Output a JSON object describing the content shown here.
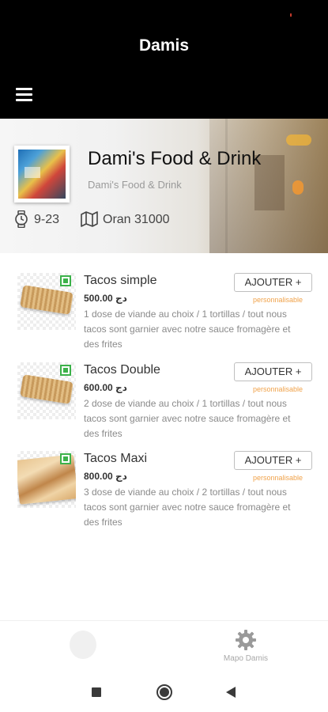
{
  "app": {
    "title": "Damis"
  },
  "header": {
    "menu_icon": "hamburger-menu-icon"
  },
  "restaurant": {
    "name": "Dami's Food & Drink",
    "subtitle": "Dami's Food & Drink",
    "hours": "9-23",
    "location": "Oran 31000",
    "hours_icon": "watch-icon",
    "location_icon": "map-icon"
  },
  "menu": {
    "items": [
      {
        "name": "Tacos simple",
        "price": "500.00 دج",
        "description": "1 dose de viande au choix / 1 tortillas / tout nous tacos sont garnier avec notre sauce fromagère et des frites",
        "add_label": "AJOUTER +",
        "tag": "personnalisable"
      },
      {
        "name": "Tacos Double",
        "price": "600.00 دج",
        "description": "2 dose de viande au choix / 1 tortillas / tout nous tacos sont garnier avec notre sauce fromagère et des frites",
        "add_label": "AJOUTER +",
        "tag": "personnalisable"
      },
      {
        "name": "Tacos Maxi",
        "price": "800.00 دج",
        "description": "3 dose de viande au choix / 2 tortillas / tout nous tacos sont garnier avec notre sauce fromagère et des frites",
        "add_label": "AJOUTER +",
        "tag": "personnalisable"
      }
    ]
  },
  "bottom_nav": {
    "items": [
      {
        "label": "",
        "icon": "home-icon"
      },
      {
        "label": "Mapo Damis",
        "icon": "gear-icon"
      }
    ]
  },
  "system_nav": {
    "icons": [
      "recents-square-icon",
      "home-circle-icon",
      "back-triangle-icon"
    ]
  },
  "colors": {
    "header_bg": "#000000",
    "accent_orange": "#f0a24a",
    "veg_green": "#3cb14a"
  }
}
